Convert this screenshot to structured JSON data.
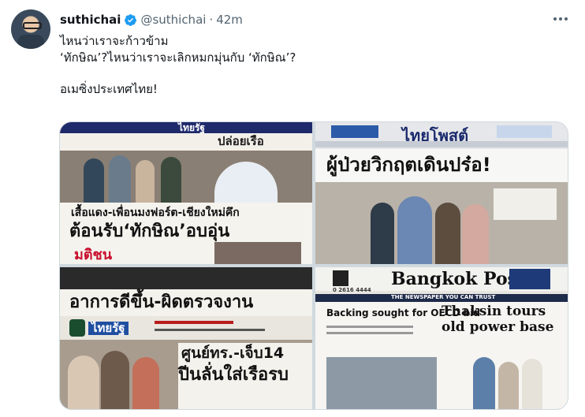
{
  "tweet": {
    "author_name": "suthichai",
    "handle": "@suthichai",
    "separator": "·",
    "time": "42m",
    "lines": [
      "ไหนว่าเราจะก้าวข้าม",
      "‘ทักษิณ’?ไหนว่าเราจะเลิกหมกมุ่นกับ ‘ทักษิณ’?",
      "",
      "อเมซิ่งประเทศไทย!"
    ]
  },
  "media": {
    "photos": [
      {
        "masthead": "ไทยรัฐ",
        "top_headline": "ปล่อยเรือ",
        "headline_1": "เสื้อแดง-เพื่อนมงฟอร์ต-เชียงใหม่คึก",
        "headline_2": "ต้อนรับ‘ทักษิณ’อบอุ่น",
        "footer": "มติชน"
      },
      {
        "masthead": "ไทยโพสต์",
        "headline": "ผู้ป่วยวิกฤตเดินปร๋อ!"
      },
      {
        "headline_1": "อาการดีขึ้น-ผิดตรวจงาน",
        "masthead": "ไทยรัฐ",
        "headline_2": "ศูนย์ทร.-เจ็บ14",
        "headline_3": "ปีนลั่นใส่เรือรบ"
      },
      {
        "masthead": "Bangkok Post",
        "tagline": "THE NEWSPAPER YOU CAN TRUST",
        "phone": "0 2616 4444",
        "side_headline": "Backing sought for OECD bid",
        "headline_1": "Thaksin tours",
        "headline_2": "old power base"
      }
    ]
  },
  "colors": {
    "verified_blue": "#1d9bf0",
    "text_primary": "#0f1419",
    "text_secondary": "#536471",
    "border": "#cfd9de"
  }
}
